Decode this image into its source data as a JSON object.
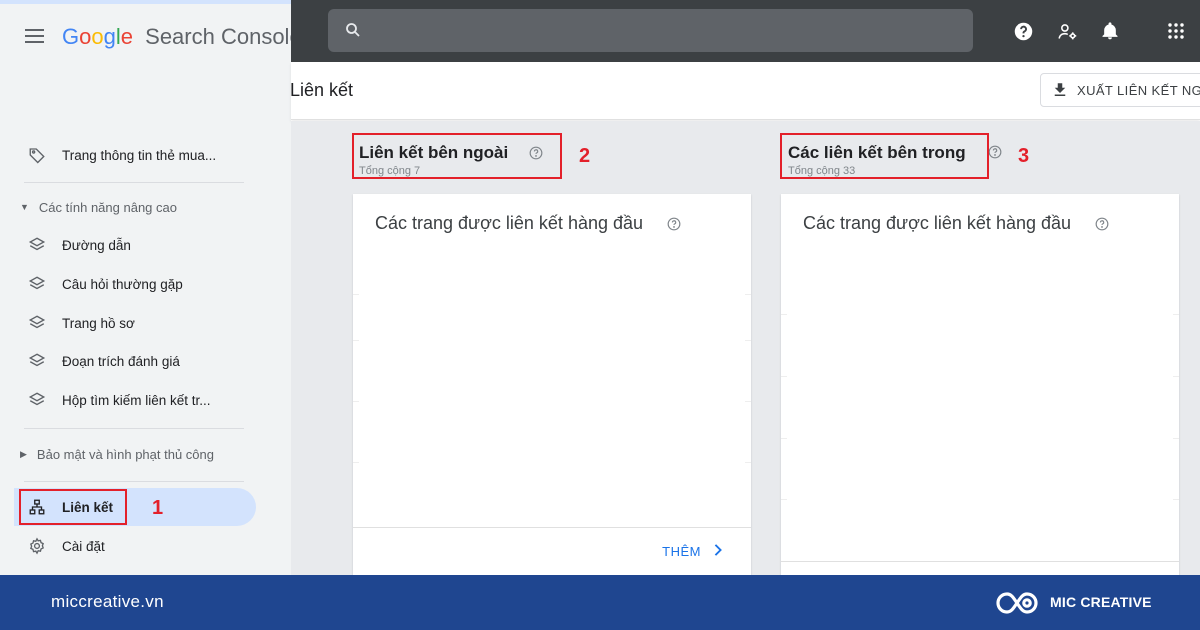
{
  "app": {
    "logo_google": [
      "G",
      "o",
      "o",
      "g",
      "l",
      "e"
    ],
    "logo_google_colors": [
      "#4285f4",
      "#ea4335",
      "#fbbc05",
      "#4285f4",
      "#34a853",
      "#ea4335"
    ],
    "logo_product": "Search Console"
  },
  "sidebar": {
    "items_top": [
      {
        "label": "Trang thông tin thẻ mua...",
        "icon": "tag-icon"
      }
    ],
    "section_advanced": "Các tính năng nâng cao",
    "advanced_items": [
      {
        "label": "Đường dẫn",
        "icon": "layers-icon"
      },
      {
        "label": "Câu hỏi thường gặp",
        "icon": "layers-icon"
      },
      {
        "label": "Trang hồ sơ",
        "icon": "layers-icon"
      },
      {
        "label": "Đoạn trích đánh giá",
        "icon": "layers-icon"
      },
      {
        "label": "Hộp tìm kiếm liên kết tr...",
        "icon": "layers-icon"
      }
    ],
    "section_security": "Bảo mật và hình phạt thủ công",
    "links_item": "Liên kết",
    "settings_item": "Cài đặt"
  },
  "search": {
    "placeholder": "",
    "value": ""
  },
  "page": {
    "title": "Liên kết",
    "export_label": "XUẤT LIÊN KẾT NG"
  },
  "external": {
    "title": "Liên kết bên ngoài",
    "total": "Tổng cộng 7",
    "card_title": "Các trang được liên kết hàng đầu",
    "more_label": "THÊM"
  },
  "internal": {
    "title": "Các liên kết bên trong",
    "total": "Tổng cộng 33",
    "card_title": "Các trang được liên kết hàng đầu"
  },
  "annotations": {
    "n1": "1",
    "n2": "2",
    "n3": "3"
  },
  "footer": {
    "site": "miccreative.vn",
    "brand": "MIC CREATIVE"
  },
  "colors": {
    "accent": "#1a73e8",
    "annotation": "#e3202a",
    "topbar": "#3c4043",
    "footer": "#1f4690"
  }
}
